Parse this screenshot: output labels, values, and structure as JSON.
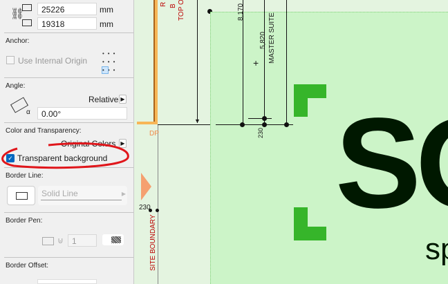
{
  "size": {
    "width_value": "25226",
    "height_value": "19318",
    "unit": "mm"
  },
  "anchor": {
    "label": "Anchor:",
    "use_internal_origin": "Use Internal Origin"
  },
  "angle": {
    "label": "Angle:",
    "mode": "Relative",
    "value": "0.00°",
    "alpha": "α"
  },
  "color": {
    "label": "Color and Transparency:",
    "mode": "Original Colors",
    "transparent_background": "Transparent background",
    "checked": true
  },
  "border_line": {
    "label": "Border Line:",
    "value": "Solid Line"
  },
  "border_pen": {
    "label": "Border Pen:",
    "value": "1"
  },
  "border_offset": {
    "label": "Border Offset:"
  },
  "drawing": {
    "dim_8170": "8,170",
    "dim_5820": "5,820",
    "master_suite": "MASTER SUITE",
    "dim_230a": "230",
    "dim_230b": "230",
    "site_boundary": "SITE BOUNDARY",
    "dp": "DP",
    "top_text": "TOP O",
    "r_text": "R",
    "b_text": "B",
    "logo_big": "SO",
    "logo_small": "sp"
  },
  "colors": {
    "accent": "#0067c0",
    "annotation_red": "#e0161b",
    "logo_green": "#36b52a",
    "zone_green": "#ccf4c8"
  }
}
